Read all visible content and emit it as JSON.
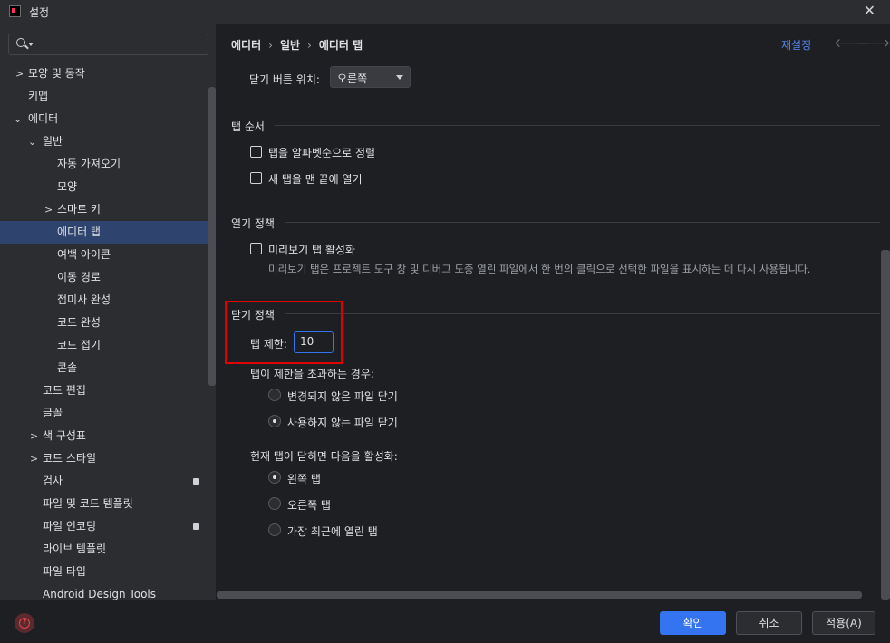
{
  "window": {
    "title": "설정"
  },
  "search": {
    "placeholder": ""
  },
  "sidebar": {
    "items": [
      {
        "label": "모양 및 동작",
        "expander": "collapsed"
      },
      {
        "label": "키맵"
      },
      {
        "label": "에디터",
        "expander": "expanded"
      },
      {
        "label": "일반",
        "expander": "expanded"
      },
      {
        "label": "자동 가져오기"
      },
      {
        "label": "모양"
      },
      {
        "label": "스마트 키",
        "expander": "collapsed"
      },
      {
        "label": "에디터 탭",
        "selected": true
      },
      {
        "label": "여백 아이콘"
      },
      {
        "label": "이동 경로"
      },
      {
        "label": "접미사 완성"
      },
      {
        "label": "코드 완성"
      },
      {
        "label": "코드 접기"
      },
      {
        "label": "콘솔"
      },
      {
        "label": "코드 편집"
      },
      {
        "label": "글꼴"
      },
      {
        "label": "색 구성표",
        "expander": "collapsed"
      },
      {
        "label": "코드 스타일",
        "expander": "collapsed"
      },
      {
        "label": "검사",
        "badge": true
      },
      {
        "label": "파일 및 코드 템플릿"
      },
      {
        "label": "파일 인코딩",
        "badge": true
      },
      {
        "label": "라이브 템플릿"
      },
      {
        "label": "파일 타입"
      },
      {
        "label": "Android Design Tools"
      }
    ]
  },
  "header": {
    "breadcrumb": [
      "에디터",
      "일반",
      "에디터 탭"
    ],
    "reset_label": "재설정"
  },
  "content": {
    "close_button_position_label": "닫기 버튼 위치:",
    "close_button_position_value": "오른쪽",
    "tab_order": {
      "title": "탭 순서",
      "sort_alpha": "탭을 알파벳순으로 정렬",
      "open_at_end": "새 탭을 맨 끝에 열기"
    },
    "opening_policy": {
      "title": "열기 정책",
      "enable_preview": "미리보기 탭 활성화",
      "preview_desc": "미리보기 탭은 프로젝트 도구 창 및 디버그 도중 열린 파일에서 한 번의 클릭으로 선택한 파일을 표시하는 데 다시 사용됩니다."
    },
    "closing_policy": {
      "title": "닫기 정책",
      "tab_limit_label": "탭 제한:",
      "tab_limit_value": "10",
      "exceed_label": "탭이 제한을 초과하는 경우:",
      "close_unchanged": "변경되지 않은 파일 닫기",
      "close_unused": "사용하지 않는 파일 닫기",
      "on_close_label": "현재 탭이 닫히면 다음을 활성화:",
      "left_tab": "왼쪽 탭",
      "right_tab": "오른쪽 탭",
      "recent_tab": "가장 최근에 열린 탭"
    }
  },
  "footer": {
    "ok": "확인",
    "cancel": "취소",
    "apply": "적용(A)"
  },
  "colors": {
    "accent": "#3574f0",
    "selection": "#2e436e",
    "highlight_box": "#e00000"
  }
}
